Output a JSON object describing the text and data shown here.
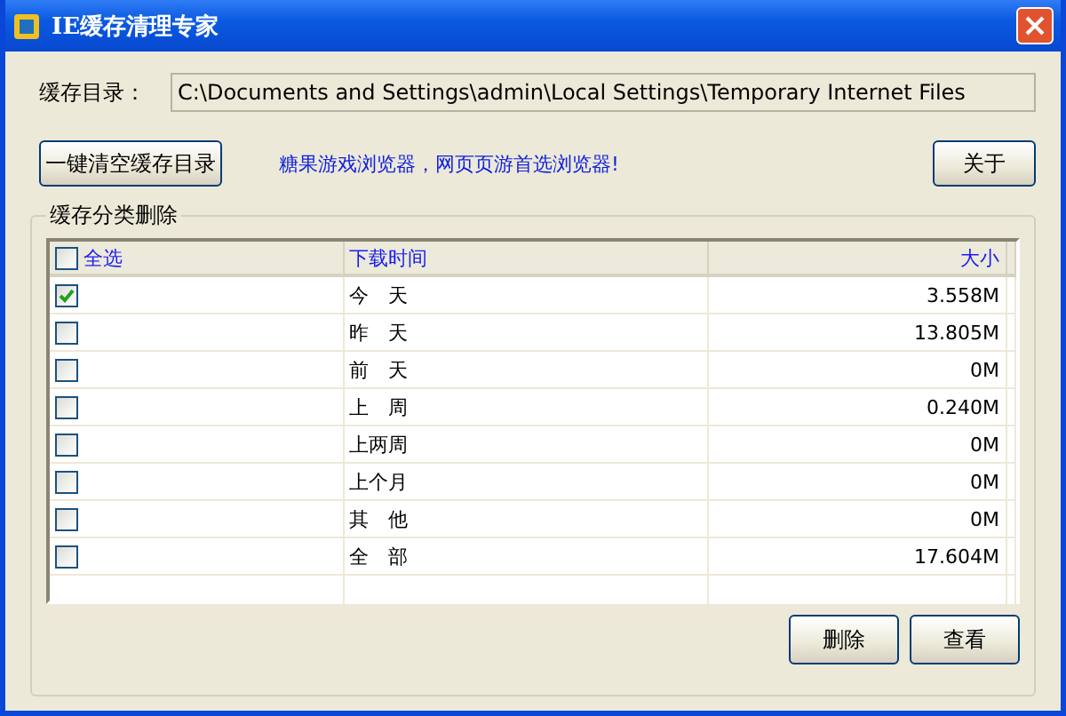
{
  "window": {
    "title": "IE缓存清理专家"
  },
  "directory": {
    "label": "缓存目录：",
    "value": "C:\\Documents and Settings\\admin\\Local Settings\\Temporary Internet Files"
  },
  "clear_button": "一键清空缓存目录",
  "promo_link": "糖果游戏浏览器，网页页游首选浏览器!",
  "about_button": "关于",
  "group": {
    "title": "缓存分类删除",
    "columns": [
      {
        "label": "全选",
        "checked": false
      },
      {
        "label": "下载时间"
      },
      {
        "label": "大小"
      }
    ],
    "rows": [
      {
        "checked": true,
        "time": "今　天",
        "size": "3.558M"
      },
      {
        "checked": false,
        "time": "昨　天",
        "size": "13.805M"
      },
      {
        "checked": false,
        "time": "前　天",
        "size": "0M"
      },
      {
        "checked": false,
        "time": "上　周",
        "size": "0.240M"
      },
      {
        "checked": false,
        "time": "上两周",
        "size": "0M"
      },
      {
        "checked": false,
        "time": "上个月",
        "size": "0M"
      },
      {
        "checked": false,
        "time": "其　他",
        "size": "0M"
      },
      {
        "checked": false,
        "time": "全　部",
        "size": "17.604M"
      }
    ],
    "buttons": [
      "删除",
      "查看"
    ]
  }
}
